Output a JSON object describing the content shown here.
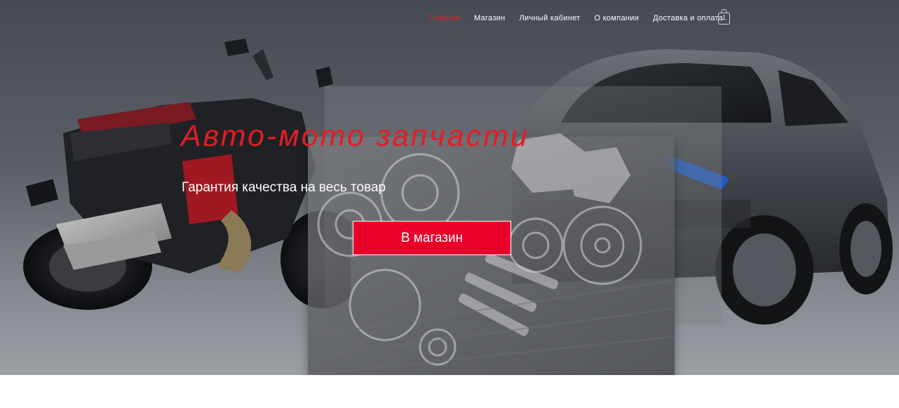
{
  "nav": {
    "items": [
      {
        "label": "Главная",
        "active": true
      },
      {
        "label": "Магазин",
        "active": false
      },
      {
        "label": "Личный кабинет",
        "active": false
      },
      {
        "label": "О компании",
        "active": false
      },
      {
        "label": "Доставка и оплата",
        "active": false
      }
    ],
    "cart_count": "1"
  },
  "hero": {
    "title": "Авто-мото запчасти",
    "subtitle": "Гарантия качества на весь товар",
    "cta_label": "В магазин"
  },
  "colors": {
    "accent": "#e8002b",
    "title": "#e51c23",
    "nav_active": "#e4202b"
  },
  "icons": {
    "cart": "shopping-bag-icon"
  }
}
